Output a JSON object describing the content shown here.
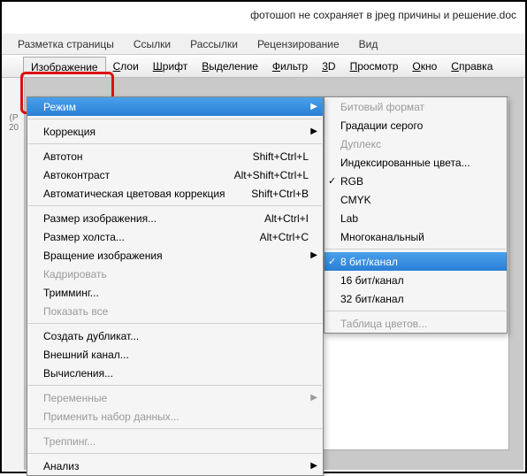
{
  "title": "фотошоп не сохраняет в jpeg причины и решение.doc",
  "tabs": [
    "Разметка страницы",
    "Ссылки",
    "Рассылки",
    "Рецензирование",
    "Вид"
  ],
  "menubar": {
    "image": "Изображение",
    "layers": "Слои",
    "type": "Шрифт",
    "select": "Выделение",
    "filter": "Фильтр",
    "threeD": "3D",
    "view": "Просмотр",
    "window": "Окно",
    "help": "Справка"
  },
  "main": {
    "mode": "Режим",
    "adjustments": "Коррекция",
    "autotone": {
      "l": "Автотон",
      "s": "Shift+Ctrl+L"
    },
    "autocontrast": {
      "l": "Автоконтраст",
      "s": "Alt+Shift+Ctrl+L"
    },
    "autocolor": {
      "l": "Автоматическая цветовая коррекция",
      "s": "Shift+Ctrl+B"
    },
    "imagesize": {
      "l": "Размер изображения...",
      "s": "Alt+Ctrl+I"
    },
    "canvassize": {
      "l": "Размер холста...",
      "s": "Alt+Ctrl+C"
    },
    "rotation": "Вращение изображения",
    "crop": "Кадрировать",
    "trim": "Тримминг...",
    "reveal": "Показать все",
    "duplicate": "Создать дубликат...",
    "apply": "Внешний канал...",
    "calc": "Вычисления...",
    "variables": "Переменные",
    "dataset": "Применить набор данных...",
    "trap": "Треппинг...",
    "analysis": "Анализ"
  },
  "sub": {
    "bitmap": "Битовый формат",
    "gray": "Градации серого",
    "duotone": "Дуплекс",
    "indexed": "Индексированные цвета...",
    "rgb": "RGB",
    "cmyk": "CMYK",
    "lab": "Lab",
    "multi": "Многоканальный",
    "b8": "8 бит/канал",
    "b16": "16 бит/канал",
    "b32": "32 бит/канал",
    "colortable": "Таблица цветов..."
  },
  "leftmarker": "(Р\n20"
}
